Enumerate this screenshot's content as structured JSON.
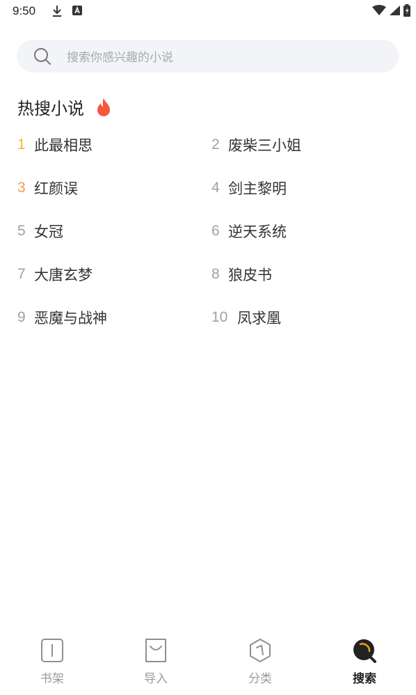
{
  "status_bar": {
    "time": "9:50"
  },
  "search": {
    "placeholder": "搜索你感兴趣的小说"
  },
  "hot_section": {
    "title": "热搜小说"
  },
  "colors": {
    "rank1": "#f5b82e",
    "rank3": "#f0a04b",
    "rank_default": "#a0a0a0",
    "accent": "#f0a020",
    "fire": "#f5573a"
  },
  "hot_list": [
    {
      "rank": "1",
      "title": "此最相思"
    },
    {
      "rank": "2",
      "title": "废柴三小姐"
    },
    {
      "rank": "3",
      "title": "红颜误"
    },
    {
      "rank": "4",
      "title": "剑主黎明"
    },
    {
      "rank": "5",
      "title": "女冠"
    },
    {
      "rank": "6",
      "title": "逆天系统"
    },
    {
      "rank": "7",
      "title": "大唐玄梦"
    },
    {
      "rank": "8",
      "title": "狼皮书"
    },
    {
      "rank": "9",
      "title": "恶魔与战神"
    },
    {
      "rank": "10",
      "title": "凤求凰"
    }
  ],
  "tabs": [
    {
      "label": "书架",
      "icon": "bookshelf-icon"
    },
    {
      "label": "导入",
      "icon": "import-bag-icon"
    },
    {
      "label": "分类",
      "icon": "category-hexagon-icon"
    },
    {
      "label": "搜索",
      "icon": "search-tab-icon",
      "active": true
    }
  ]
}
